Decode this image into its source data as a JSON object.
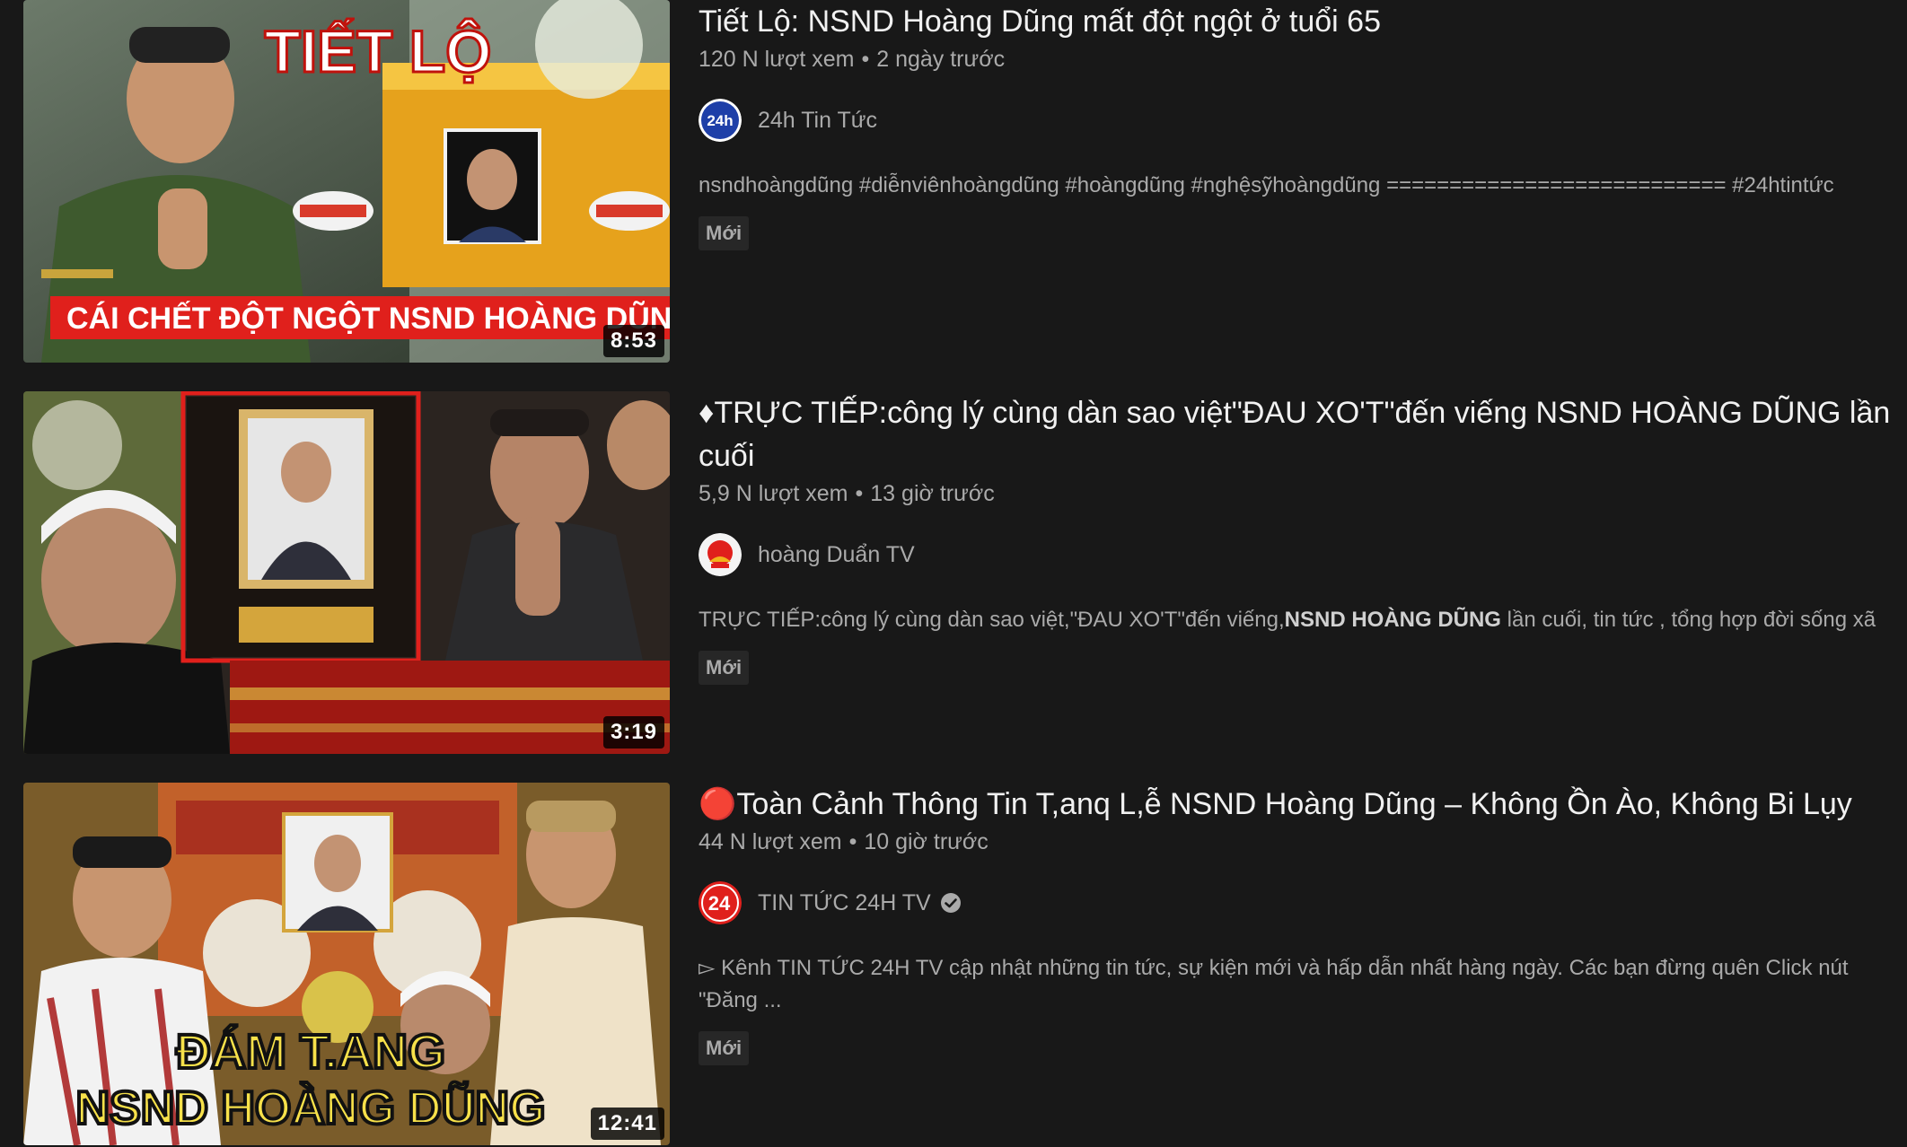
{
  "videos": [
    {
      "title": "Tiết Lộ: NSND Hoàng Dũng mất đột ngột ở tuổi 65",
      "views": "120 N lượt xem",
      "age": "2 ngày trước",
      "channel": "24h Tin Tức",
      "verified": false,
      "description": "nsndhoàngdũng #diễnviênhoàngdũng #hoàngdũng #nghệsỹhoàngdũng =========================== #24htintức",
      "badge": "Mới",
      "duration": "8:53",
      "thumb_text_top": "TIẾT LỘ",
      "thumb_text_bottom": "CÁI CHẾT ĐỘT NGỘT NSND HOÀNG DŨNG",
      "avatar_text": "24h"
    },
    {
      "title": "♦TRỰC TIẾP:công lý cùng dàn sao việt\"ĐAU XO'T\"đến viếng NSND HOÀNG DŨNG lần cuối",
      "views": "5,9 N lượt xem",
      "age": "13 giờ trước",
      "channel": "hoàng Duẩn TV",
      "verified": false,
      "description_pre": "TRỰC TIẾP:công lý cùng dàn sao việt,\"ĐAU XO'T\"đến viếng,",
      "description_bold": "NSND HOÀNG DŨNG",
      "description_post": " lần cuối, tin tức , tổng hợp đời sống xã",
      "badge": "Mới",
      "duration": "3:19"
    },
    {
      "title": "🔴Toàn Cảnh Thông Tin T,anq L,ễ NSND Hoàng Dũng – Không Ồn Ào, Không Bi Lụy",
      "views": "44 N lượt xem",
      "age": "10 giờ trước",
      "channel": "TIN TỨC 24H TV",
      "verified": true,
      "description": "▻ Kênh TIN TỨC 24H TV cập nhật những tin tức, sự kiện mới và hấp dẫn nhất hàng ngày. Các bạn đừng quên Click nút \"Đăng ...",
      "badge": "Mới",
      "duration": "12:41",
      "thumb_text_line1": "ĐÁM T.ANG",
      "thumb_text_line2": "NSND HOÀNG DŨNG",
      "avatar_text": "24"
    }
  ],
  "colors": {
    "background": "#181818",
    "title": "#f1f1f1",
    "meta": "#aaaaaa",
    "badge_bg": "#272727",
    "accent_red": "#e0201c"
  }
}
